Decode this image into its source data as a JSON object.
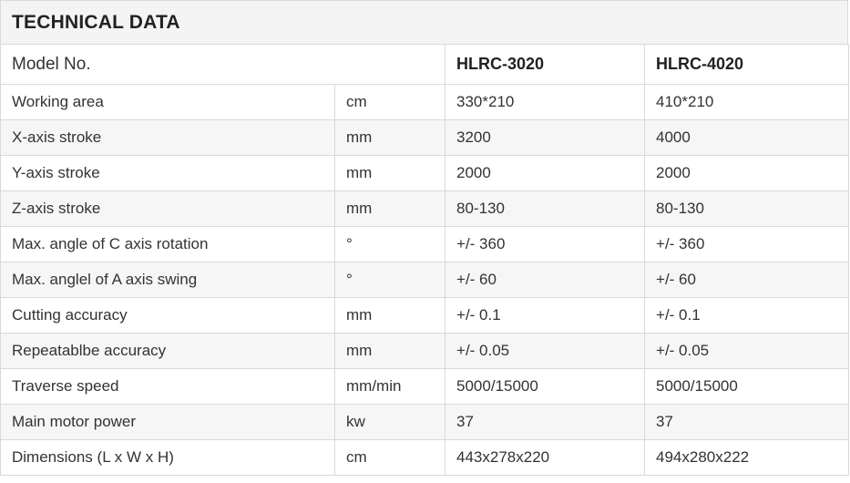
{
  "title": "TECHNICAL  DATA",
  "header": {
    "label": "Model No.",
    "models": [
      "HLRC-3020",
      "HLRC-4020"
    ]
  },
  "rows": [
    {
      "param": "Working area",
      "unit": "cm",
      "v1": "330*210",
      "v2": "410*210"
    },
    {
      "param": "X-axis stroke",
      "unit": "mm",
      "v1": "3200",
      "v2": "4000"
    },
    {
      "param": "Y-axis stroke",
      "unit": "mm",
      "v1": "2000",
      "v2": "2000"
    },
    {
      "param": "Z-axis stroke",
      "unit": "mm",
      "v1": "80-130",
      "v2": "80-130"
    },
    {
      "param": "Max. angle of C axis rotation",
      "unit": "°",
      "v1": "+/- 360",
      "v2": "+/- 360"
    },
    {
      "param": "Max. anglel of A axis swing",
      "unit": "°",
      "v1": "+/- 60",
      "v2": "+/- 60"
    },
    {
      "param": "Cutting accuracy",
      "unit": "mm",
      "v1": "+/- 0.1",
      "v2": "+/- 0.1"
    },
    {
      "param": "Repeatablbe accuracy",
      "unit": "mm",
      "v1": "+/- 0.05",
      "v2": "+/- 0.05"
    },
    {
      "param": "Traverse speed",
      "unit": "mm/min",
      "v1": "5000/15000",
      "v2": "5000/15000"
    },
    {
      "param": "Main motor power",
      "unit": "kw",
      "v1": "37",
      "v2": "37"
    },
    {
      "param": "Dimensions (L x W x H)",
      "unit": "cm",
      "v1": "443x278x220",
      "v2": "494x280x222"
    }
  ]
}
